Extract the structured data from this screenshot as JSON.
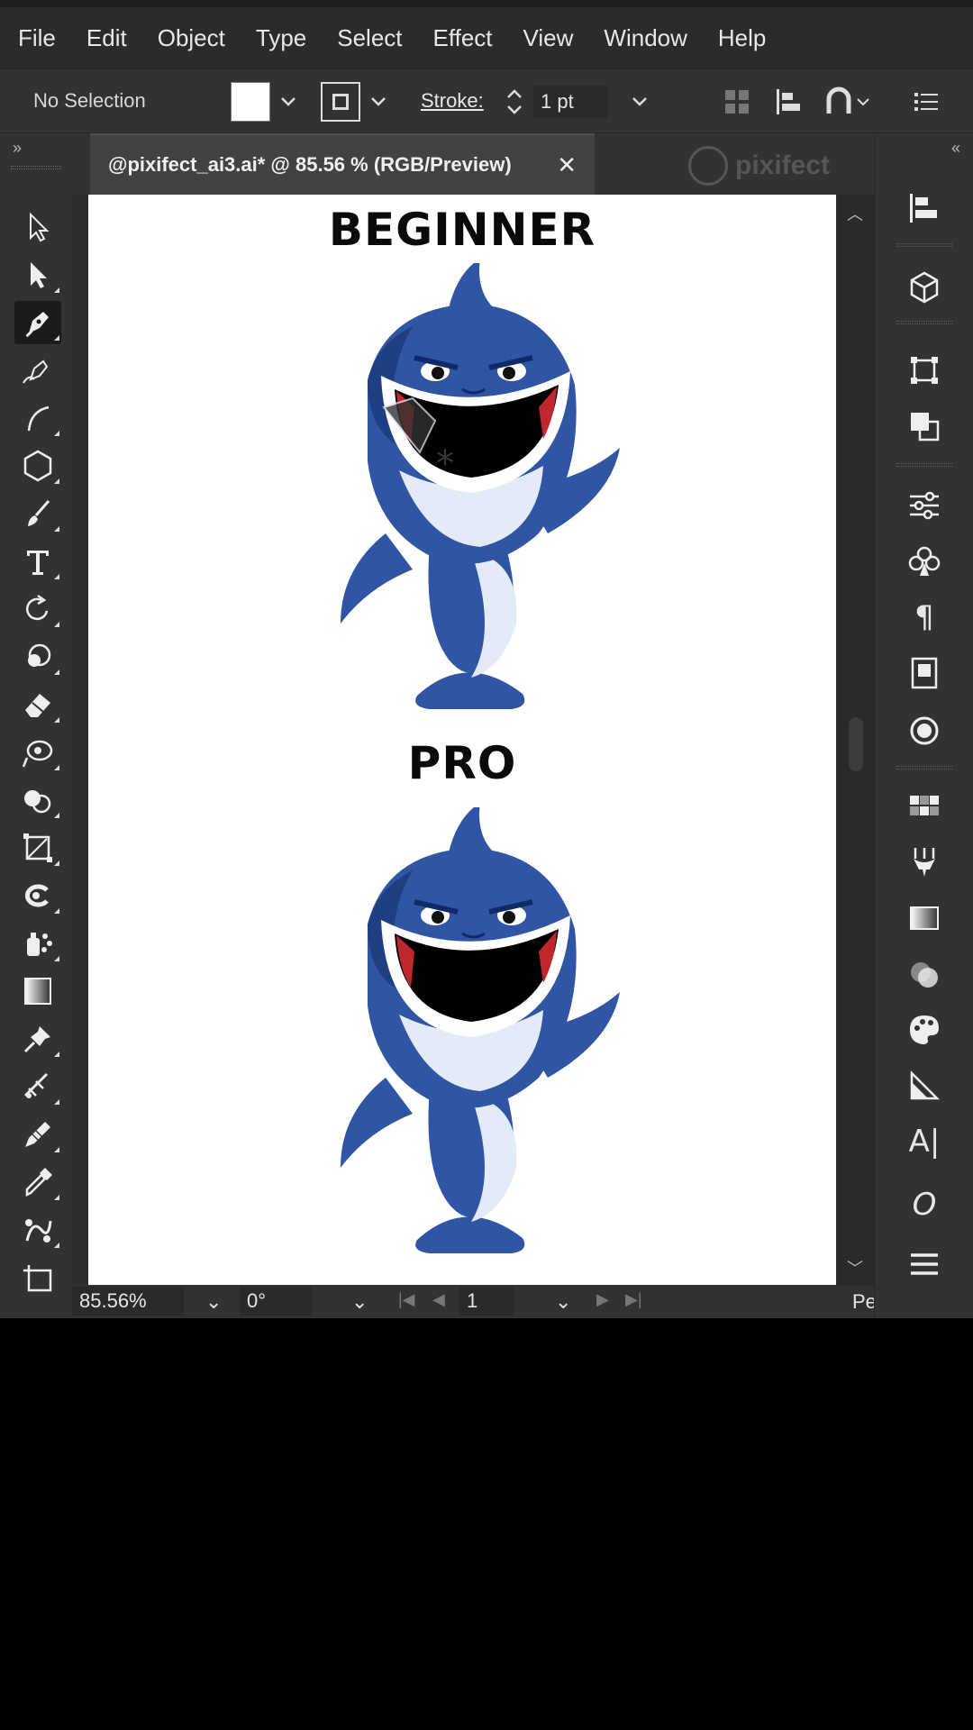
{
  "menu": [
    "File",
    "Edit",
    "Object",
    "Type",
    "Select",
    "Effect",
    "View",
    "Window",
    "Help"
  ],
  "control_bar": {
    "selection_status": "No Selection",
    "fill_color": "#ffffff",
    "stroke_label": "Stroke:",
    "stroke_weight": "1 pt"
  },
  "document": {
    "tab_title": "@pixifect_ai3.ai* @ 85.56 % (RGB/Preview)",
    "close_symbol": "✕",
    "watermark": "pixifect"
  },
  "artboard": {
    "title_top": "BEGINNER",
    "title_bottom": "PRO",
    "shark_colors": {
      "body": "#2f55a4",
      "dark": "#1f3f83",
      "belly": "#e4ebf8",
      "mouth": "#000000",
      "tongue": "#c0262d"
    }
  },
  "status_bar": {
    "zoom": "85.56%",
    "rotation": "0°",
    "artboard_number": "1",
    "truncated_label": "Pe"
  },
  "tools": [
    "selection-tool-icon",
    "direct-selection-tool-icon",
    "pen-tool-icon",
    "curvature-tool-icon",
    "arc-tool-icon",
    "polygon-tool-icon",
    "paintbrush-tool-icon",
    "type-tool-icon",
    "rotate-tool-icon",
    "scale-tool-icon",
    "eraser-tool-icon",
    "puppet-warp-tool-icon",
    "shape-builder-tool-icon",
    "artboard-crop-tool-icon",
    "warp-tool-icon",
    "symbol-sprayer-tool-icon",
    "gradient-tool-icon",
    "pin-tool-icon",
    "measure-tool-icon",
    "pencil-tool-icon",
    "eyedropper-tool-icon",
    "blend-tool-icon",
    "artboard-tool-icon"
  ],
  "right_panels": [
    "align-icon",
    "3d-cube-icon",
    "transform-icon",
    "pathfinder-icon",
    "properties-sliders-icon",
    "symbols-club-icon",
    "paragraph-icon",
    "libraries-icon",
    "appearance-icon",
    "swatches-icon",
    "brushes-icon",
    "gradient-panel-icon",
    "transparency-icon",
    "color-palette-icon",
    "graphic-styles-icon",
    "character-icon",
    "opentype-icon",
    "menu-icon"
  ],
  "ui_colors": {
    "menubar": "#2b2b2b",
    "panel": "#323232",
    "active_tool": "#1b1b1b",
    "tab": "#424242",
    "artboard": "#ffffff"
  }
}
